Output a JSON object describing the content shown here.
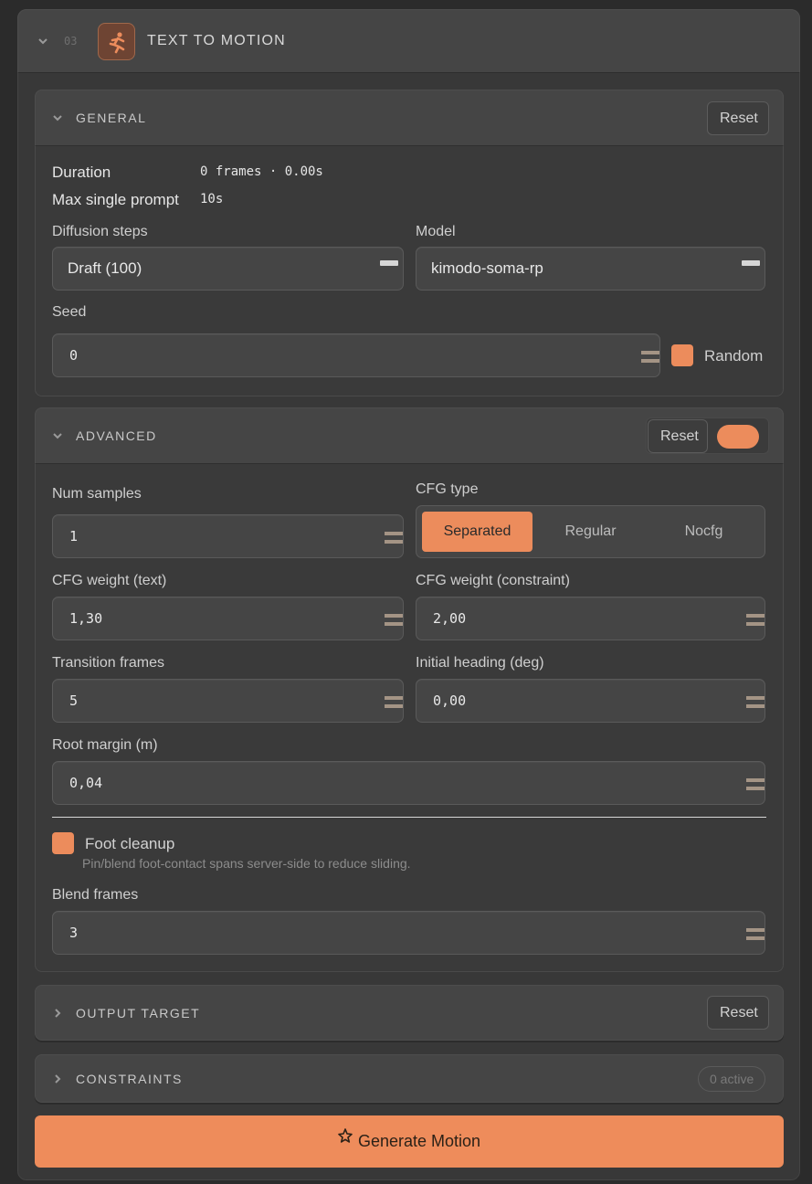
{
  "panel": {
    "number": "03",
    "title": "TEXT TO MOTION",
    "icon": "running-figure-icon",
    "accent": "#ec8c5c"
  },
  "general": {
    "title": "GENERAL",
    "reset_label": "Reset",
    "duration_label": "Duration",
    "duration_value": "0 frames · 0.00s",
    "max_prompt_label": "Max single prompt",
    "max_prompt_value": "10s",
    "diffusion_label": "Diffusion steps",
    "diffusion_value": "Draft (100)",
    "model_label": "Model",
    "model_value": "kimodo-soma-rp",
    "seed_label": "Seed",
    "seed_value": "0",
    "random_label": "Random"
  },
  "advanced": {
    "title": "ADVANCED",
    "reset_label": "Reset",
    "num_samples_label": "Num samples",
    "num_samples_value": "1",
    "cfg_type_label": "CFG type",
    "cfg_options": [
      "Separated",
      "Regular",
      "Nocfg"
    ],
    "cfg_selected": "Separated",
    "cfg_text_label": "CFG weight (text)",
    "cfg_text_value": "1,30",
    "cfg_constraint_label": "CFG weight (constraint)",
    "cfg_constraint_value": "2,00",
    "transition_label": "Transition frames",
    "transition_value": "5",
    "heading_label": "Initial heading (deg)",
    "heading_value": "0,00",
    "root_margin_label": "Root margin (m)",
    "root_margin_value": "0,04",
    "foot_cleanup_label": "Foot cleanup",
    "foot_cleanup_hint": "Pin/blend foot-contact spans server-side to reduce sliding.",
    "blend_frames_label": "Blend frames",
    "blend_frames_value": "3"
  },
  "output_target": {
    "title": "OUTPUT TARGET",
    "reset_label": "Reset"
  },
  "constraints": {
    "title": "CONSTRAINTS",
    "badge": "0 active"
  },
  "generate_label": "Generate Motion"
}
